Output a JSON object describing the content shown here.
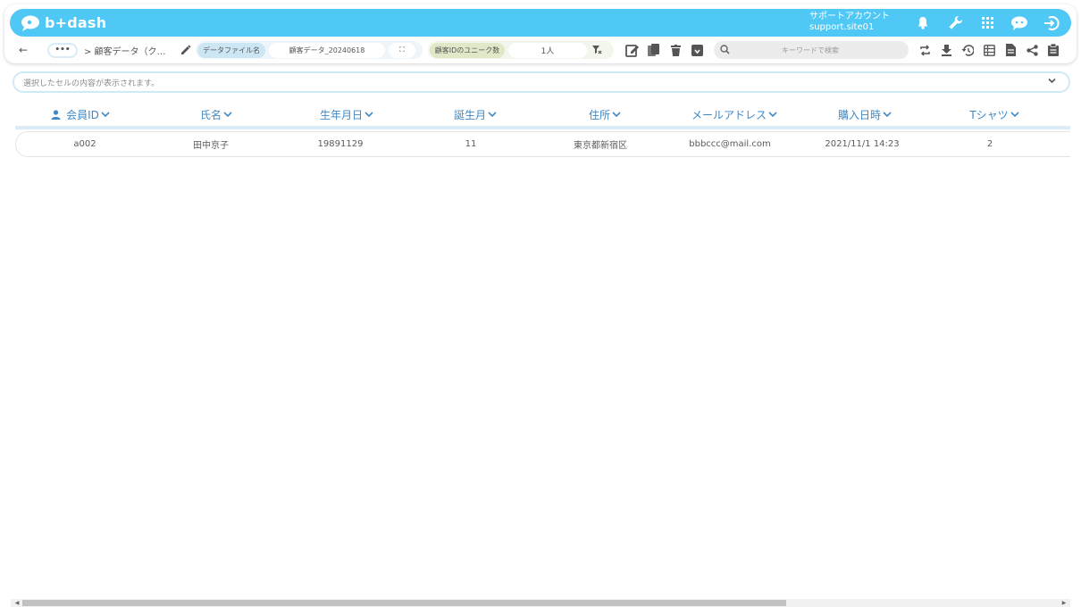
{
  "app": {
    "logo_text": "b+dash",
    "brand_color": "#4fc8f5"
  },
  "account": {
    "name": "サポートアカウント",
    "site": "support.site01"
  },
  "top_icons": [
    "bell-icon",
    "wrench-icon",
    "apps-grid-icon",
    "chat-bot-icon",
    "logout-icon"
  ],
  "toolbar": {
    "back_label": "←",
    "more_label": "•••",
    "breadcrumb": "> 顧客データ（ク…",
    "file_label": "データファイル名",
    "file_value": "顧客データ_20240618",
    "expand_label": "⛶",
    "metric_label": "顧客IDのユニーク数",
    "metric_value": "1人",
    "search_placeholder": "キーワードで検索"
  },
  "selection_bar": {
    "placeholder": "選択したセルの内容が表示されます。"
  },
  "table": {
    "columns": [
      "会員ID",
      "氏名",
      "生年月日",
      "誕生月",
      "住所",
      "メールアドレス",
      "購入日時",
      "Tシャツ"
    ],
    "rows": [
      [
        "a002",
        "田中京子",
        "19891129",
        "11",
        "東京都新宿区",
        "bbbccc@mail.com",
        "2021/11/1 14:23",
        "2"
      ]
    ]
  }
}
